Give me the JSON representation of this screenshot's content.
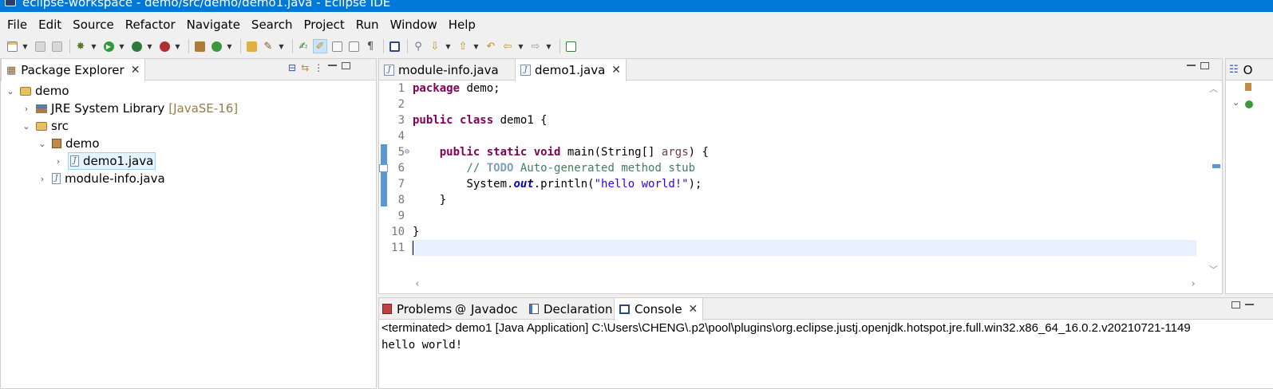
{
  "window": {
    "title": "eclipse-workspace - demo/src/demo/demo1.java - Eclipse IDE"
  },
  "menu": [
    "File",
    "Edit",
    "Source",
    "Refactor",
    "Navigate",
    "Search",
    "Project",
    "Run",
    "Window",
    "Help"
  ],
  "package_explorer": {
    "tab_label": "Package Explorer",
    "tree": [
      {
        "label": "demo",
        "decoration": "",
        "icon": "java-project-icon",
        "twisty": "expanded"
      },
      {
        "label": "JRE System Library",
        "decoration": "[JavaSE-16]",
        "icon": "library-icon",
        "twisty": "collapsed"
      },
      {
        "label": "src",
        "decoration": "",
        "icon": "source-folder-icon",
        "twisty": "expanded"
      },
      {
        "label": "demo",
        "decoration": "",
        "icon": "package-icon",
        "twisty": "expanded"
      },
      {
        "label": "demo1.java",
        "decoration": "",
        "icon": "java-file-icon",
        "twisty": "collapsed",
        "selected": true
      },
      {
        "label": "module-info.java",
        "decoration": "",
        "icon": "java-file-icon",
        "twisty": "collapsed"
      }
    ]
  },
  "editor": {
    "tabs": [
      {
        "label": "module-info.java",
        "active": false
      },
      {
        "label": "demo1.java",
        "active": true
      }
    ],
    "line_numbers": [
      "1",
      "2",
      "3",
      "4",
      "5",
      "6",
      "7",
      "8",
      "9",
      "10",
      "11"
    ],
    "code": {
      "l1_kw": "package",
      "l1_rest": " demo;",
      "l3_kw1": "public",
      "l3_kw2": "class",
      "l3_rest": " demo1 {",
      "l5_kw1": "public",
      "l5_kw2": "static",
      "l5_kw3": "void",
      "l5_mid": " main(String[] ",
      "l5_param": "args",
      "l5_end": ") {",
      "l6_c1": "// ",
      "l6_todo": "TODO",
      "l6_c2": " Auto-generated method stub",
      "l7_a": "System.",
      "l7_field": "out",
      "l7_b": ".println(",
      "l7_str": "\"hello world!\"",
      "l7_c": ");",
      "l8": "}",
      "l10": "}"
    },
    "folding_marker": "⊖"
  },
  "bottom": {
    "tabs": [
      "Problems",
      "Javadoc",
      "Declaration",
      "Console"
    ],
    "active_tab": "Console",
    "console_header": "<terminated> demo1 [Java Application] C:\\Users\\CHENG\\.p2\\pool\\plugins\\org.eclipse.justj.openjdk.hotspot.jre.full.win32.x86_64_16.0.2.v20210721-1149",
    "console_output": "hello world!"
  },
  "outline": {
    "tab_label_partial": "O"
  },
  "colors": {
    "title_bar": "#0078d7",
    "keyword": "#7f0055",
    "comment": "#3f7f5f",
    "string": "#2a00ff",
    "current_line": "#e8f2fe"
  }
}
